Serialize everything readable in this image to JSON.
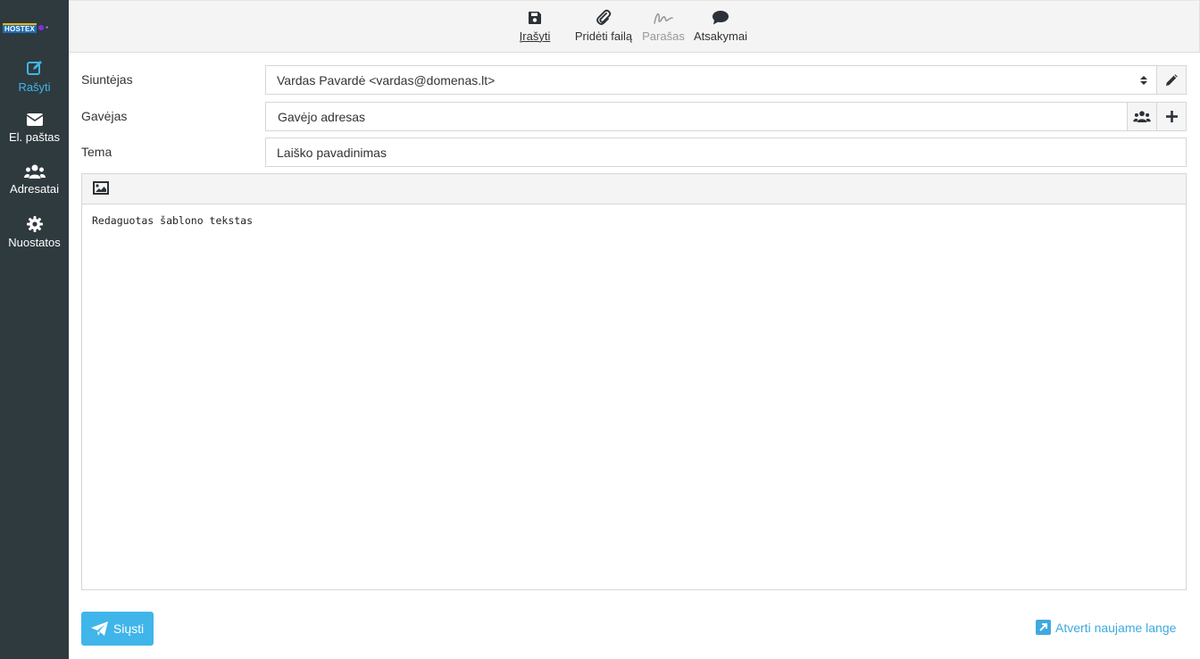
{
  "sidebar": {
    "logo_text": "HOSTEX",
    "items": [
      {
        "label": "Rašyti",
        "icon": "edit-icon",
        "active": true
      },
      {
        "label": "El. paštas",
        "icon": "envelope-icon"
      },
      {
        "label": "Adresatai",
        "icon": "users-icon"
      },
      {
        "label": "Nuostatos",
        "icon": "gear-icon"
      }
    ]
  },
  "toolbar": {
    "save_label": "Įrašyti",
    "attach_label": "Pridėti failą",
    "signature_label": "Parašas",
    "replies_label": "Atsakymai"
  },
  "form": {
    "from_label": "Siuntėjas",
    "from_value": "Vardas Pavardė <vardas@domenas.lt>",
    "to_label": "Gavėjas",
    "to_placeholder": "Gavėjo adresas",
    "subject_label": "Tema",
    "subject_placeholder": "Laiško pavadinimas"
  },
  "editor": {
    "body_text": "Redaguotas šablono tekstas"
  },
  "footer": {
    "send_label": "Siųsti",
    "open_new_label": "Atverti naujame lange"
  },
  "colors": {
    "sidebar_bg": "#2f3a3f",
    "accent": "#3fb5ea"
  }
}
